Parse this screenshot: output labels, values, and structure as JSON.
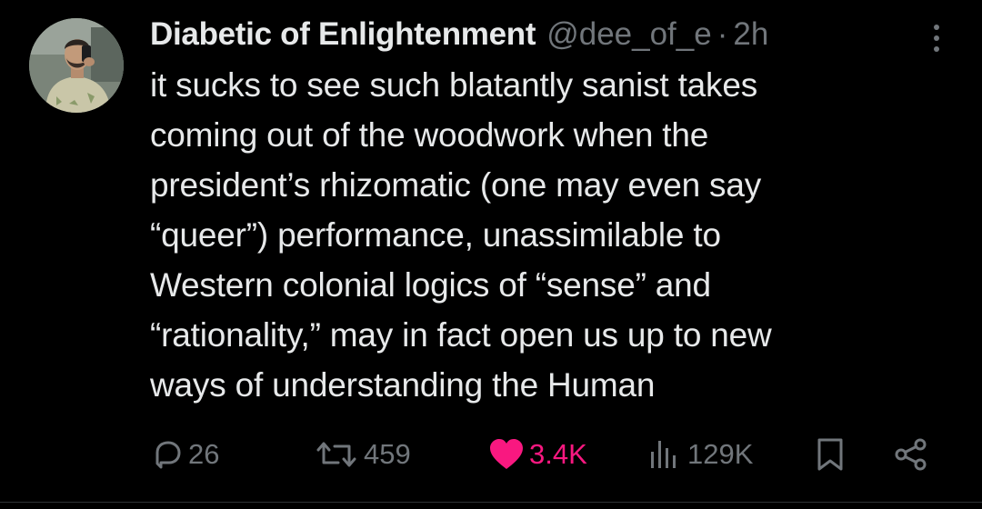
{
  "tweet": {
    "display_name": "Diabetic of Enlightenment",
    "handle": "@dee_of_e",
    "separator": "·",
    "time": "2h",
    "body_lines": [
      "it sucks to see such blatantly sanist takes",
      "coming out of the woodwork when the",
      "president’s rhizomatic (one may even say",
      "“queer”) performance, unassimilable to",
      "Western colonial logics of “sense” and",
      "“rationality,” may in fact open us up to new",
      "ways of understanding the Human"
    ]
  },
  "actions": {
    "replies": "26",
    "reposts": "459",
    "likes": "3.4K",
    "views": "129K"
  },
  "icons": {
    "reply": "reply-bubble-icon",
    "repost": "repost-arrows-icon",
    "like": "heart-filled-icon",
    "views": "bar-chart-icon",
    "bookmark": "bookmark-icon",
    "share": "share-nodes-icon",
    "more": "more-vertical-dots-icon"
  },
  "colors": {
    "background": "#000000",
    "text_primary": "#e7e9ea",
    "text_secondary": "#71767b",
    "like_active": "#f91880"
  }
}
